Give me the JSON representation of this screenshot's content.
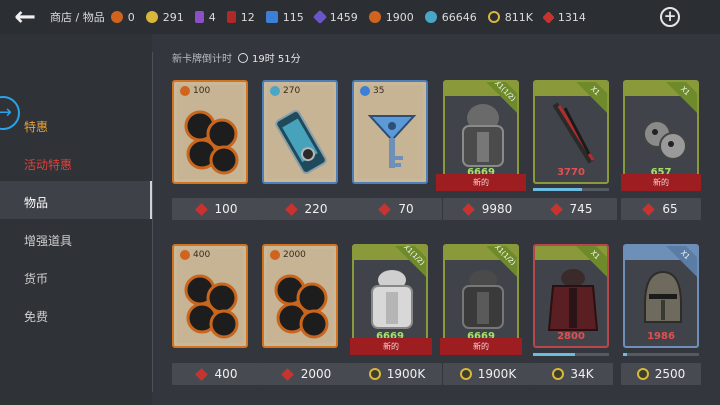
{
  "header": {
    "back_icon": "back-arrow-icon",
    "breadcrumb": "商店 / 物品",
    "resources": [
      {
        "icon": "orange-rune-icon",
        "color": "#d0641f",
        "value": "0"
      },
      {
        "icon": "gold-coin-icon",
        "color": "#d8b73a",
        "value": "291"
      },
      {
        "icon": "purple-card-icon",
        "color": "#8d4fc6",
        "value": "4"
      },
      {
        "icon": "red-card-icon",
        "color": "#b02828",
        "value": "12"
      },
      {
        "icon": "blue-key-icon",
        "color": "#3c7fd6",
        "value": "115"
      },
      {
        "icon": "purple-shard-icon",
        "color": "#6b56c9",
        "value": "1459"
      },
      {
        "icon": "orange-medal-icon",
        "color": "#d0641f",
        "value": "1900"
      },
      {
        "icon": "teal-orb-icon",
        "color": "#4aa6c7",
        "value": "66646"
      },
      {
        "icon": "coin-ring-icon",
        "color": "#d8b73a",
        "value": "811K"
      },
      {
        "icon": "red-gem-icon",
        "color": "#c8322f",
        "value": "1314"
      }
    ],
    "plus_icon": "add-currency-icon"
  },
  "sidebar": {
    "items": [
      {
        "label": "特惠",
        "color": "#e8a23a"
      },
      {
        "label": "活动特惠",
        "color": "#e0403a"
      },
      {
        "label": "物品",
        "color": "#ffffff"
      },
      {
        "label": "增强道具",
        "color": "#cfcfcf"
      },
      {
        "label": "货币",
        "color": "#cfcfcf"
      },
      {
        "label": "免费",
        "color": "#cfcfcf"
      }
    ]
  },
  "timer": {
    "label": "新卡牌倒计时",
    "value": "19时 51分"
  },
  "new_tag": "新的",
  "cards": [
    {
      "qty": "100",
      "price": "100",
      "price_icon": "gem"
    },
    {
      "qty": "270",
      "price": "220",
      "price_icon": "gem"
    },
    {
      "qty": "35",
      "price": "70",
      "price_icon": "gem"
    },
    {
      "corner": "X1(1/2)",
      "score": "6669",
      "price": "9980",
      "price_icon": "gem",
      "new": true
    },
    {
      "corner": "X1",
      "score": "3770",
      "price": "745",
      "price_icon": "gem",
      "progress": 0.65
    },
    {
      "corner": "X1",
      "score": "657",
      "price": "65",
      "price_icon": "gem",
      "new": true
    },
    {
      "qty": "400",
      "price": "400",
      "price_icon": "gem"
    },
    {
      "qty": "2000",
      "price": "2000",
      "price_icon": "gem"
    },
    {
      "corner": "X1(1/2)",
      "score": "6669",
      "price": "1900K",
      "price_icon": "coin",
      "new": true
    },
    {
      "corner": "X1(1/2)",
      "score": "6669",
      "price": "1900K",
      "price_icon": "coin",
      "new": true
    },
    {
      "corner": "X1",
      "score": "2800",
      "price": "34K",
      "price_icon": "coin",
      "progress": 0.55
    },
    {
      "corner": "X1",
      "score": "1986",
      "price": "2500",
      "price_icon": "coin",
      "progress": 0.05
    }
  ]
}
